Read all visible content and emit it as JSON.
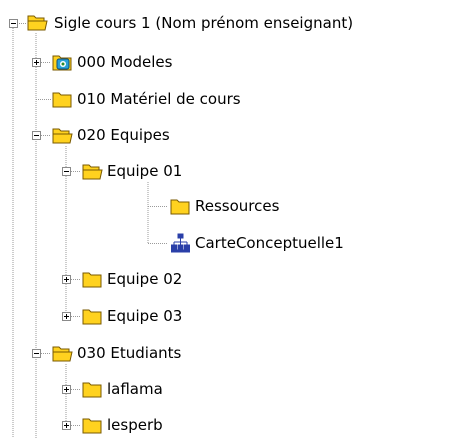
{
  "tree": {
    "root": {
      "label": "Sigle cours 1 (Nom prénom enseignant)",
      "icon": "folder-open-icon",
      "expanded": true
    },
    "items": [
      {
        "label": "000 Modeles",
        "icon": "template-folder-icon",
        "expanded": false
      },
      {
        "label": "010 Matériel de cours",
        "icon": "folder-icon"
      },
      {
        "label": "020 Equipes",
        "icon": "folder-open-icon",
        "expanded": true
      },
      {
        "label": "Equipe 01",
        "icon": "folder-open-icon",
        "expanded": true
      },
      {
        "label": "Ressources",
        "icon": "folder-icon"
      },
      {
        "label": "CarteConceptuelle1",
        "icon": "concept-map-icon"
      },
      {
        "label": "Equipe 02",
        "icon": "folder-icon",
        "expanded": false
      },
      {
        "label": "Equipe 03",
        "icon": "folder-icon",
        "expanded": false
      },
      {
        "label": "030 Etudiants",
        "icon": "folder-open-icon",
        "expanded": true
      },
      {
        "label": "laflama",
        "icon": "folder-icon",
        "expanded": false
      },
      {
        "label": "lesperb",
        "icon": "folder-icon",
        "expanded": false
      }
    ]
  },
  "colors": {
    "folder_fill": "#ffd21f",
    "folder_outline": "#7a5a00",
    "guide_line": "#9a9a9a",
    "concept_map": "#2a3fa8"
  }
}
